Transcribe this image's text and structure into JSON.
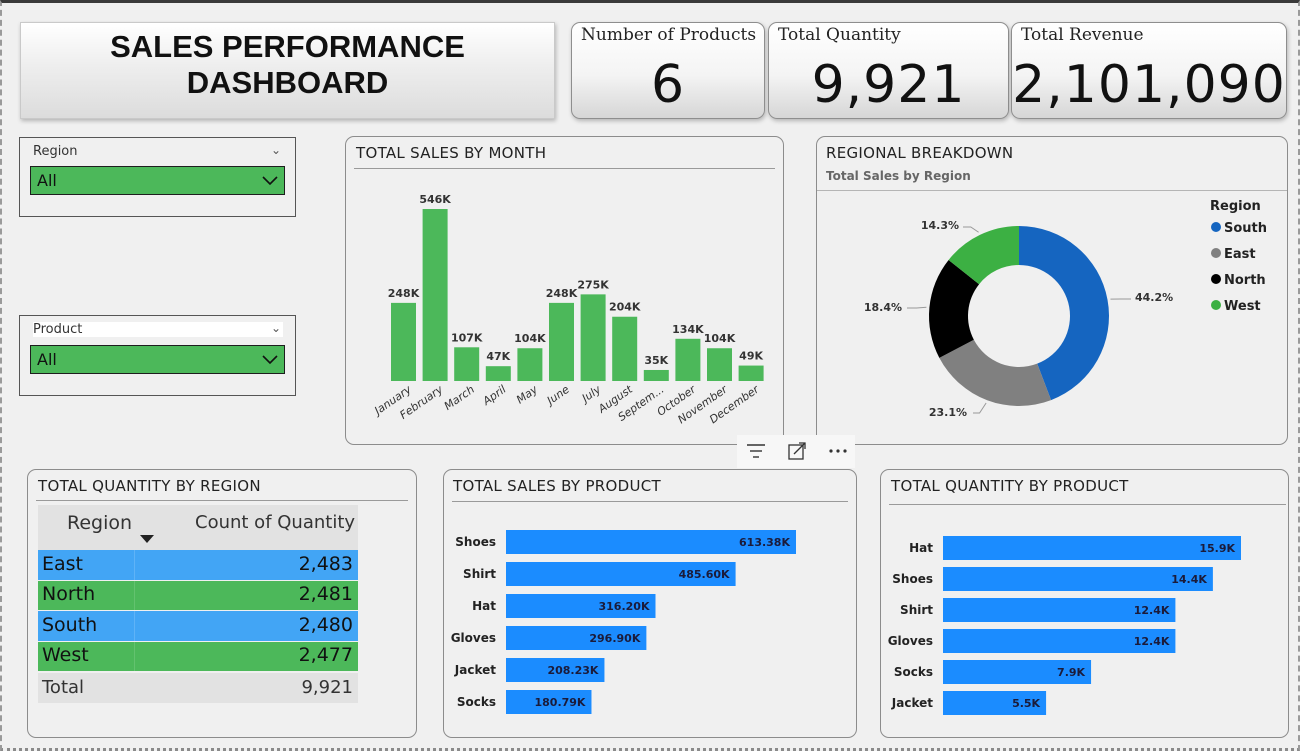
{
  "header": {
    "title_line1": "SALES PERFORMANCE",
    "title_line2": "DASHBOARD"
  },
  "kpis": [
    {
      "label": "Number of Products",
      "value": "6"
    },
    {
      "label": "Total Quantity",
      "value": "9,921"
    },
    {
      "label": "Total Revenue",
      "value": "2,101,090"
    }
  ],
  "slicers": {
    "region": {
      "label": "Region",
      "selected": "All"
    },
    "product": {
      "label": "Product",
      "selected": "All"
    }
  },
  "visual_header_icons": [
    "filter-icon",
    "focus-mode-icon",
    "more-options-icon"
  ],
  "colors": {
    "green": "#4cb85a",
    "blue": "#1b8cff",
    "south": "#1565c0",
    "east": "#808080",
    "north": "#000000",
    "west": "#3cb043",
    "table_blue": "#42a5f5",
    "table_green": "#4cb85a"
  },
  "charts": {
    "sales_by_month_title": "TOTAL SALES BY MONTH",
    "regional_title": "REGIONAL BREAKDOWN",
    "regional_subtitle": "Total Sales by Region",
    "qty_by_region_title": "TOTAL QUANTITY BY REGION",
    "sales_by_product_title": "TOTAL SALES BY PRODUCT",
    "qty_by_product_title": "TOTAL QUANTITY BY PRODUCT"
  },
  "qty_table": {
    "headers": [
      "Region",
      "Count of Quantity"
    ],
    "rows": [
      {
        "region": "East",
        "value": "2,483"
      },
      {
        "region": "North",
        "value": "2,481"
      },
      {
        "region": "South",
        "value": "2,480"
      },
      {
        "region": "West",
        "value": "2,477"
      }
    ],
    "total_label": "Total",
    "total_value": "9,921"
  },
  "chart_data": [
    {
      "type": "bar",
      "title": "TOTAL SALES BY MONTH",
      "categories": [
        "January",
        "February",
        "March",
        "April",
        "May",
        "June",
        "July",
        "August",
        "Septem...",
        "October",
        "November",
        "December"
      ],
      "values": [
        248000,
        546000,
        107000,
        47000,
        104000,
        248000,
        275000,
        204000,
        35000,
        134000,
        104000,
        49000
      ],
      "data_labels": [
        "248K",
        "546K",
        "107K",
        "47K",
        "104K",
        "248K",
        "275K",
        "204K",
        "35K",
        "134K",
        "104K",
        "49K"
      ],
      "ylim": [
        0,
        546000
      ],
      "grid": false
    },
    {
      "type": "pie",
      "title": "REGIONAL BREAKDOWN",
      "subtitle": "Total Sales by Region",
      "legend_title": "Region",
      "legend_position": "right",
      "categories": [
        "South",
        "East",
        "North",
        "West"
      ],
      "values": [
        44.2,
        23.1,
        18.4,
        14.3
      ],
      "data_labels": [
        "44.2%",
        "23.1%",
        "18.4%",
        "14.3%"
      ]
    },
    {
      "type": "bar",
      "orientation": "horizontal",
      "title": "TOTAL SALES BY PRODUCT",
      "categories": [
        "Shoes",
        "Shirt",
        "Hat",
        "Gloves",
        "Jacket",
        "Socks"
      ],
      "values": [
        613380,
        485600,
        316200,
        296900,
        208230,
        180790
      ],
      "data_labels": [
        "613.38K",
        "485.60K",
        "316.20K",
        "296.90K",
        "208.23K",
        "180.79K"
      ]
    },
    {
      "type": "bar",
      "orientation": "horizontal",
      "title": "TOTAL QUANTITY BY PRODUCT",
      "categories": [
        "Hat",
        "Shoes",
        "Shirt",
        "Gloves",
        "Socks",
        "Jacket"
      ],
      "values": [
        15900,
        14400,
        12400,
        12400,
        7900,
        5500
      ],
      "data_labels": [
        "15.9K",
        "14.4K",
        "12.4K",
        "12.4K",
        "7.9K",
        "5.5K"
      ]
    }
  ]
}
